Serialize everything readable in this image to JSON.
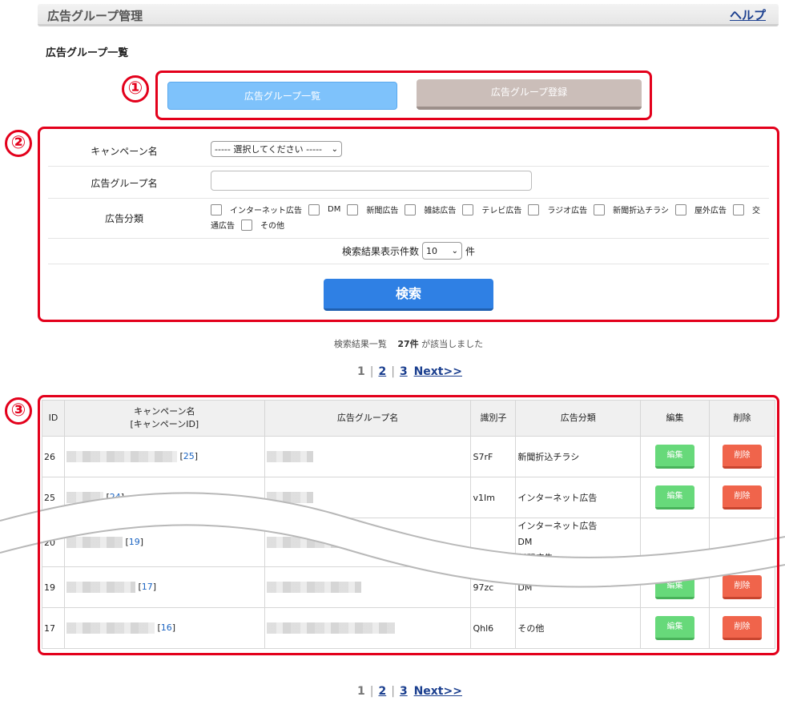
{
  "header": {
    "title": "広告グループ管理",
    "help_label": "ヘルプ"
  },
  "section_title": "広告グループ一覧",
  "callouts": [
    "①",
    "②",
    "③"
  ],
  "tabs": {
    "list_label": "広告グループ一覧",
    "register_label": "広告グループ登録"
  },
  "form": {
    "campaign_label": "キャンペーン名",
    "campaign_select_value": "----- 選択してください -----",
    "adgroup_label": "広告グループ名",
    "adgroup_value": "",
    "category_label": "広告分類",
    "categories": [
      "インターネット広告",
      "DM",
      "新聞広告",
      "雑誌広告",
      "テレビ広告",
      "ラジオ広告",
      "新聞折込チラシ",
      "屋外広告",
      "交通広告",
      "その他"
    ],
    "category_line1": [
      "インターネット広告",
      "DM",
      "新聞広告",
      "雑誌広告",
      "テレビ広告",
      "ラジオ広告",
      "新聞折込チラシ",
      "屋外広告"
    ],
    "category_wrap_start": "交",
    "category_wrap_end": "通広告",
    "category_last": "その他",
    "per_page_label": "検索結果表示件数",
    "per_page_value": "10",
    "per_page_unit": "件",
    "search_button": "検索"
  },
  "results": {
    "prefix": "検索結果一覧",
    "count": "27件",
    "suffix": "が該当しました"
  },
  "pager": {
    "current": "1",
    "pages": [
      "2",
      "3"
    ],
    "next": "Next>>"
  },
  "table": {
    "headers": {
      "id": "ID",
      "campaign_line1": "キャンペーン名",
      "campaign_line2": "[キャンペーンID]",
      "adgroup": "広告グループ名",
      "code": "識別子",
      "category": "広告分類",
      "edit": "編集",
      "delete": "削除"
    },
    "rows": [
      {
        "id": "26",
        "campaign_id": "25",
        "code": "S7rF",
        "category": "新聞折込チラシ"
      },
      {
        "id": "25",
        "campaign_id": "24",
        "code": "v1Im",
        "category": "インターネット広告"
      },
      {
        "id": "20",
        "campaign_id": "19",
        "code": "",
        "category_lines": [
          "インターネット広告",
          "DM",
          "新聞広告"
        ]
      },
      {
        "id": "19",
        "campaign_id": "17",
        "code": "97zc",
        "category": "DM"
      },
      {
        "id": "17",
        "campaign_id": "16",
        "code": "Qhl6",
        "category": "その他"
      }
    ],
    "edit_label": "編集",
    "delete_label": "削除"
  },
  "colors": {
    "callout_red": "#e3001b",
    "primary_blue": "#2f80e4",
    "tab_blue": "#7ec2fb",
    "edit_green": "#67d97a",
    "delete_red": "#f0644b",
    "link_blue": "#1b3f8f"
  }
}
